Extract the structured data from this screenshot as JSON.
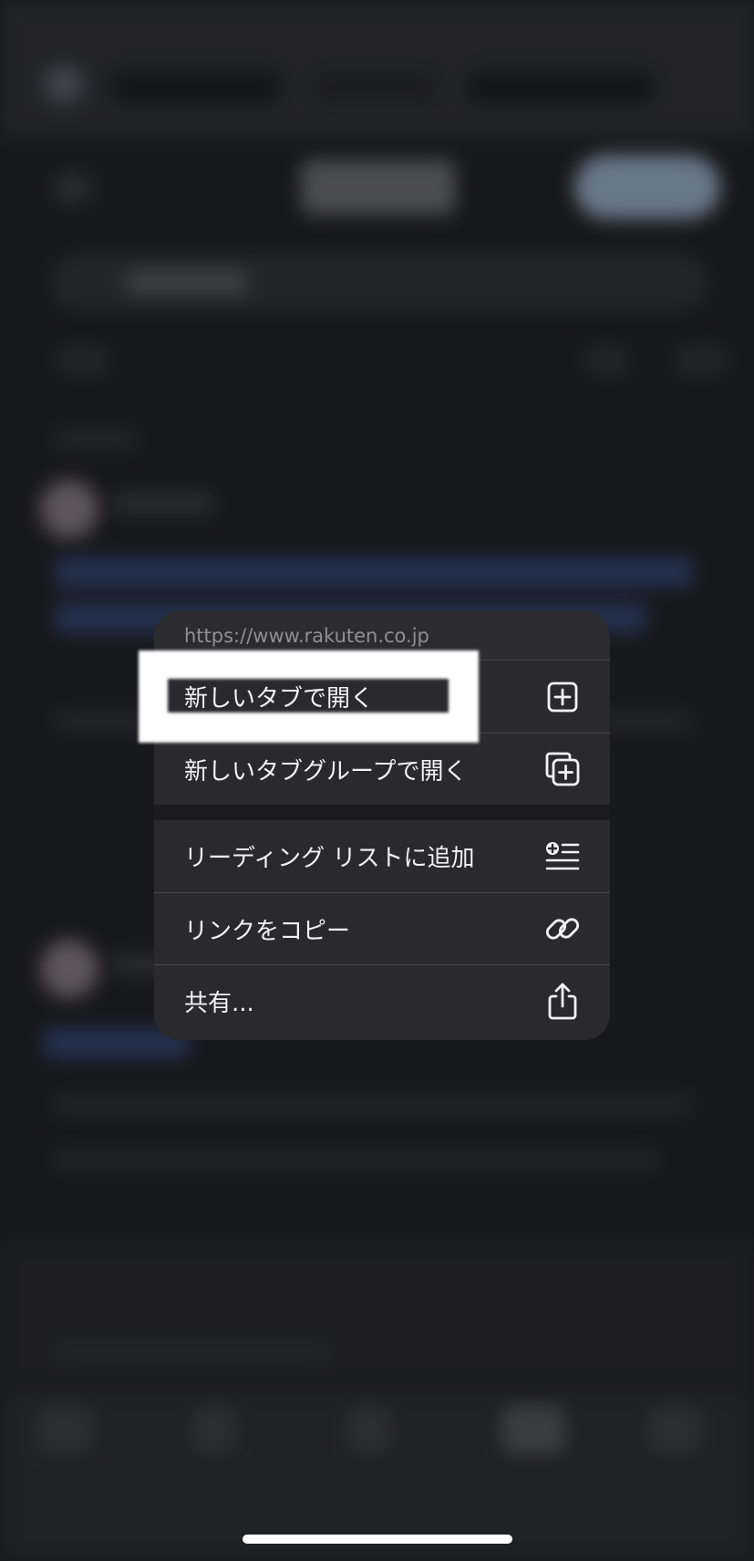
{
  "menu": {
    "url": "https://www.rakuten.co.jp",
    "items": [
      {
        "label": "新しいタブで開く",
        "icon": "plus-square-icon"
      },
      {
        "label": "新しいタブグループで開く",
        "icon": "plus-square-stack-icon"
      },
      {
        "label": "リーディング リストに追加",
        "icon": "add-to-reading-list-icon"
      },
      {
        "label": "リンクをコピー",
        "icon": "link-icon"
      },
      {
        "label": "共有...",
        "icon": "share-icon"
      }
    ]
  },
  "colors": {
    "menu_background": "#2a2a2e",
    "menu_text": "#f2f2f4",
    "url_text": "#8e8e94",
    "highlight": "#ffffff"
  }
}
